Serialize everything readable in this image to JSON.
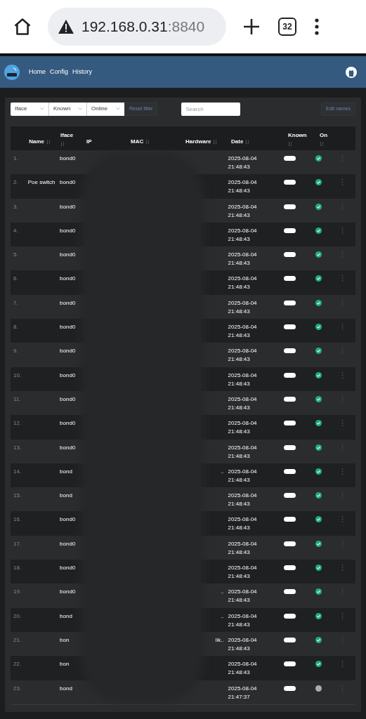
{
  "browser": {
    "url_host": "192.168.0.31",
    "url_port": ":8840",
    "tab_count": "32"
  },
  "nav": {
    "links": [
      "Home",
      "Config",
      "History"
    ]
  },
  "filters": {
    "dropdowns": [
      "Iface",
      "Known",
      "Online"
    ],
    "reset_button": "Reset filter",
    "search": {
      "placeholder": "Search"
    },
    "edit_button": "Edit names"
  },
  "table": {
    "columns": [
      {
        "label": "Name",
        "sortable": true
      },
      {
        "label": "Iface",
        "sortable": true
      },
      {
        "label": "IP",
        "sortable": false
      },
      {
        "label": "MAC",
        "sortable": true
      },
      {
        "label": "Hardware",
        "sortable": true
      },
      {
        "label": "Date",
        "sortable": true
      },
      {
        "label": "Known",
        "sortable": true
      },
      {
        "label": "On",
        "sortable": true
      }
    ],
    "rows": [
      {
        "index": "1.",
        "iface": "bond0",
        "date": "2025-08-04 21:48:43",
        "known": true,
        "online": true
      },
      {
        "index": "2.",
        "name": "Poe switch",
        "iface": "bond0",
        "date": "2025-08-04 21:48:43",
        "known": true,
        "online": true
      },
      {
        "index": "3.",
        "iface": "bond0",
        "date": "2025-08-04 21:48:43",
        "known": true,
        "online": true
      },
      {
        "index": "4.",
        "iface": "bond0",
        "date": "2025-08-04 21:48:43",
        "known": true,
        "online": true
      },
      {
        "index": "5.",
        "iface": "bond0",
        "date": "2025-08-04 21:48:43",
        "known": true,
        "online": true
      },
      {
        "index": "6.",
        "iface": "bond0",
        "date": "2025-08-04 21:48:43",
        "known": true,
        "online": true
      },
      {
        "index": "7.",
        "iface": "bond0",
        "date": "2025-08-04 21:48:43",
        "known": true,
        "online": true
      },
      {
        "index": "8.",
        "iface": "bond0",
        "date": "2025-08-04 21:48:43",
        "known": true,
        "online": true
      },
      {
        "index": "9.",
        "iface": "bond0",
        "date": "2025-08-04 21:48:43",
        "known": true,
        "online": true
      },
      {
        "index": "10.",
        "iface": "bond0",
        "date": "2025-08-04 21:48:43",
        "known": true,
        "online": true
      },
      {
        "index": "11.",
        "iface": "bond0",
        "date": "2025-08-04 21:48:43",
        "known": true,
        "online": true
      },
      {
        "index": "12.",
        "iface": "bond0",
        "date": "2025-08-04 21:48:43",
        "known": true,
        "online": true
      },
      {
        "index": "13.",
        "iface": "bond0",
        "date": "2025-08-04 21:48:43",
        "known": true,
        "online": true
      },
      {
        "index": "14.",
        "iface": "bond",
        "hardware": "..",
        "date": "2025-08-04 21:48:43",
        "known": true,
        "online": true
      },
      {
        "index": "15.",
        "iface": "bond",
        "date": "2025-08-04 21:48:43",
        "known": true,
        "online": true
      },
      {
        "index": "16.",
        "iface": "bond0",
        "date": "2025-08-04 21:48:43",
        "known": true,
        "online": true
      },
      {
        "index": "17.",
        "iface": "bond0",
        "date": "2025-08-04 21:48:43",
        "known": true,
        "online": true
      },
      {
        "index": "18.",
        "iface": "bond0",
        "date": "2025-08-04 21:48:43",
        "known": true,
        "online": true
      },
      {
        "index": "19.",
        "iface": "bond0",
        "hardware": "..",
        "date": "2025-08-04 21:48:43",
        "known": true,
        "online": true
      },
      {
        "index": "20.",
        "iface": "bond",
        "hardware": "..",
        "date": "2025-08-04 21:48:43",
        "known": true,
        "online": true
      },
      {
        "index": "21.",
        "iface": "bon",
        "hardware": "lik..",
        "date": "2025-08-04 21:48:43",
        "known": true,
        "online": true
      },
      {
        "index": "22.",
        "iface": "bon",
        "date": "2025-08-04 21:48:43",
        "known": true,
        "online": true
      },
      {
        "index": "23.",
        "iface": "bond",
        "date": "2025-08-04 21:47:37",
        "known": true,
        "online": false
      }
    ]
  }
}
